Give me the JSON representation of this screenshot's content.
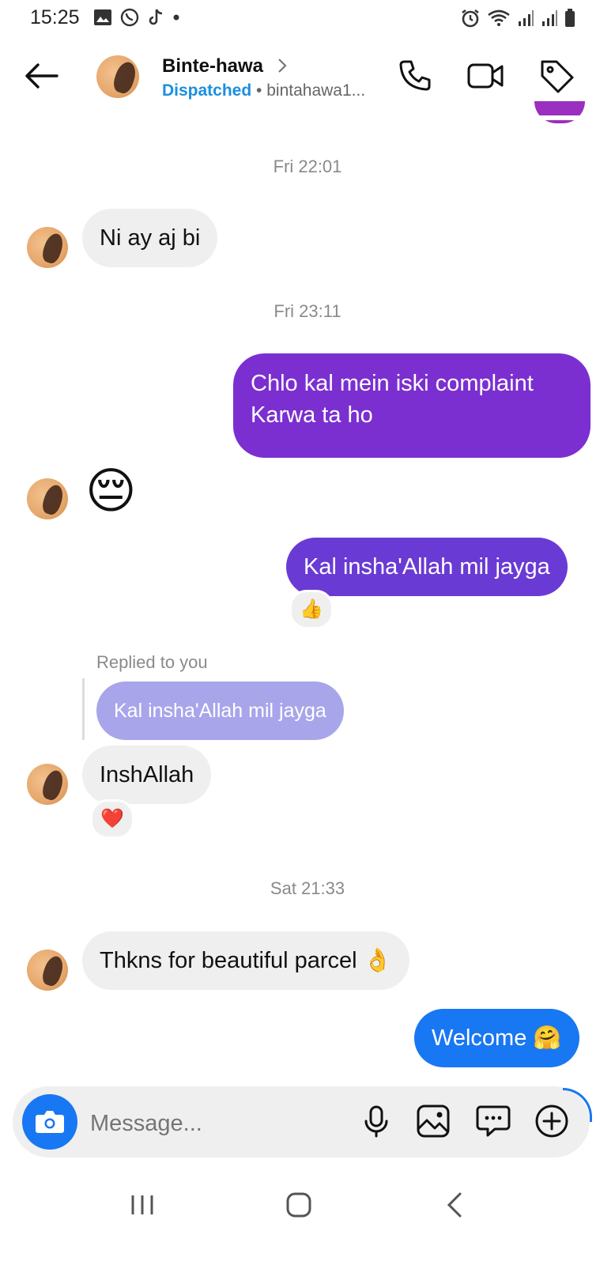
{
  "status_bar": {
    "time": "15:25"
  },
  "header": {
    "contact_name": "Binte-hawa",
    "status": "Dispatched",
    "username": "bintahawa1..."
  },
  "messages": {
    "ts1": "Fri 22:01",
    "m1": "Ni ay aj bi",
    "ts2": "Fri 23:11",
    "m2_line1": "Chlo kal mein iski complaint",
    "m2_line2": "Karwa ta ho",
    "m3": "😔",
    "m4": "Kal insha'Allah mil jayga",
    "m4_reaction": "👍",
    "replied_label": "Replied to you",
    "reply_quote": "Kal insha'Allah mil jayga",
    "m5": "InshAllah",
    "m5_reaction": "❤️",
    "ts3": "Sat 21:33",
    "m6": "Thkns for beautiful parcel 👌",
    "m7": "Welcome 🤗"
  },
  "composer": {
    "placeholder": "Message..."
  },
  "colors": {
    "outgoing_purple": "#7b2fd0",
    "outgoing_blue": "#1877f2",
    "incoming": "#efefef",
    "reply_quote": "#a8a5ea",
    "dispatched": "#1b8fe0"
  }
}
